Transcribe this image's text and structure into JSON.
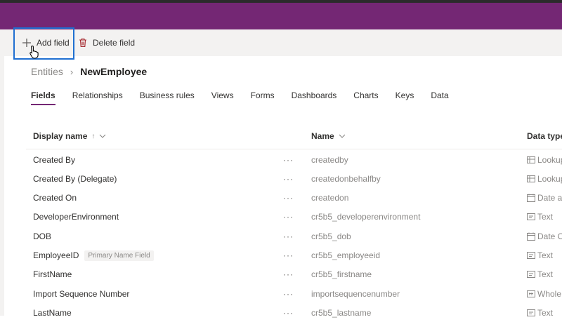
{
  "toolbar": {
    "add_field": "Add field",
    "delete_field": "Delete field"
  },
  "breadcrumb": {
    "parent": "Entities",
    "current": "NewEmployee"
  },
  "tabs": [
    {
      "label": "Fields",
      "active": true
    },
    {
      "label": "Relationships"
    },
    {
      "label": "Business rules"
    },
    {
      "label": "Views"
    },
    {
      "label": "Forms"
    },
    {
      "label": "Dashboards"
    },
    {
      "label": "Charts"
    },
    {
      "label": "Keys"
    },
    {
      "label": "Data"
    }
  ],
  "table": {
    "columns": {
      "display_name": "Display name",
      "display_name_sort": "↑",
      "name": "Name",
      "data_type": "Data type"
    },
    "row_menu": "···",
    "rows": [
      {
        "display": "Created By",
        "name": "createdby",
        "type": "Lookup",
        "icon": "lookup-icon"
      },
      {
        "display": "Created By (Delegate)",
        "name": "createdonbehalfby",
        "type": "Lookup",
        "icon": "lookup-icon"
      },
      {
        "display": "Created On",
        "name": "createdon",
        "type": "Date and",
        "icon": "calendar-icon"
      },
      {
        "display": "DeveloperEnvironment",
        "name": "cr5b5_developerenvironment",
        "type": "Text",
        "icon": "text-icon"
      },
      {
        "display": "DOB",
        "name": "cr5b5_dob",
        "type": "Date O",
        "icon": "calendar-icon"
      },
      {
        "display": "EmployeeID",
        "badge": "Primary Name Field",
        "name": "cr5b5_employeeid",
        "type": "Text",
        "icon": "text-icon"
      },
      {
        "display": "FirstName",
        "name": "cr5b5_firstname",
        "type": "Text",
        "icon": "text-icon"
      },
      {
        "display": "Import Sequence Number",
        "name": "importsequencenumber",
        "type": "Whole",
        "icon": "number-icon"
      },
      {
        "display": "LastName",
        "name": "cr5b5_lastname",
        "type": "Text",
        "icon": "text-icon"
      }
    ]
  },
  "colors": {
    "header": "#742774",
    "focus": "#1f6fd1",
    "commandbar": "#f3f2f1"
  }
}
